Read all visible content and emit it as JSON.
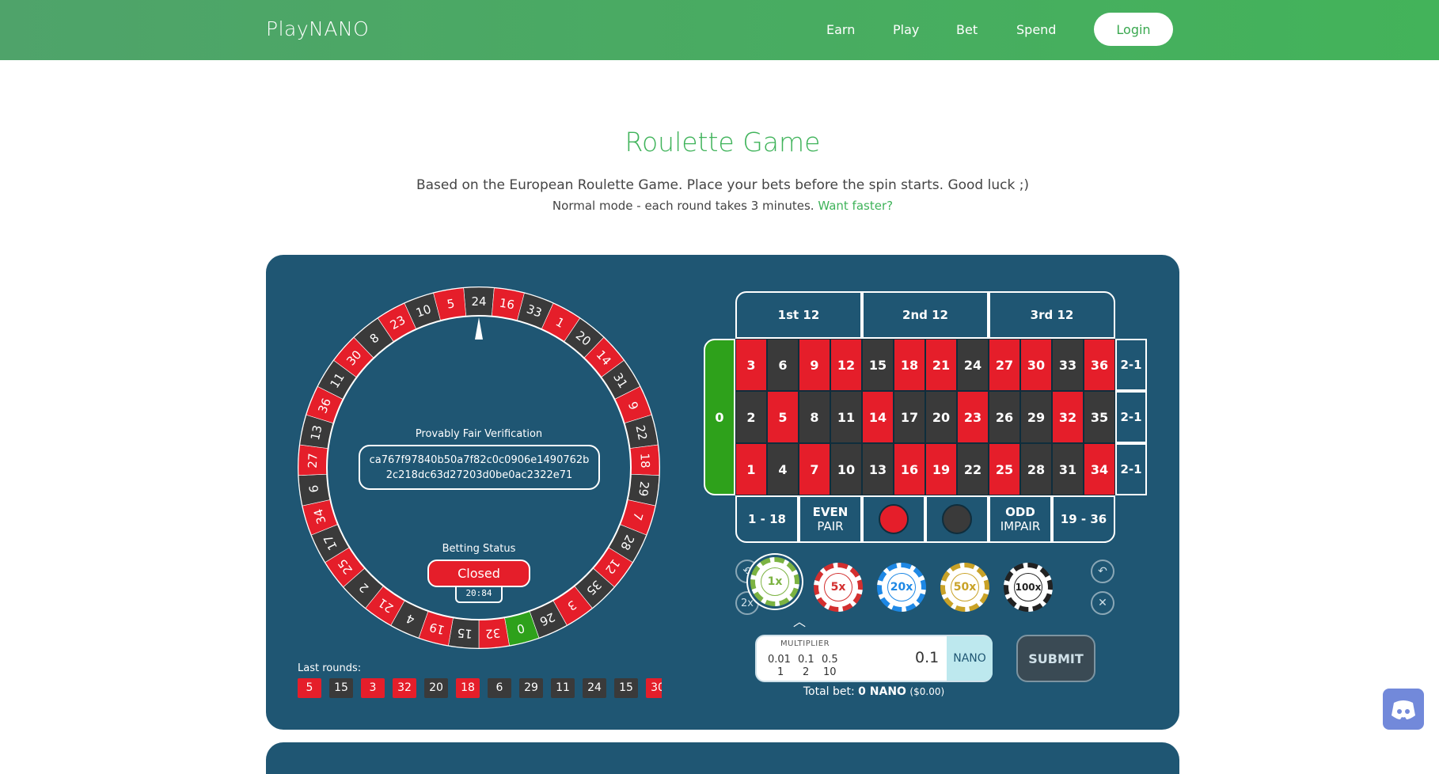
{
  "header": {
    "brand": "PlayNANO",
    "nav": [
      "Earn",
      "Play",
      "Bet",
      "Spend"
    ],
    "login_label": "Login"
  },
  "hero": {
    "title": "Roulette Game",
    "subtitle": "Based on the European Roulette Game. Place your bets before the spin starts. Good luck ;)",
    "mode_text": "Normal mode - each round takes 3 minutes.",
    "mode_link": "Want faster?"
  },
  "wheel": {
    "numbers": [
      24,
      16,
      33,
      1,
      20,
      14,
      31,
      9,
      22,
      18,
      29,
      7,
      28,
      12,
      35,
      3,
      26,
      0,
      32,
      15,
      19,
      4,
      21,
      2,
      25,
      17,
      34,
      6,
      27,
      13,
      36,
      11,
      30,
      8,
      23,
      10,
      5
    ],
    "red_numbers": [
      1,
      3,
      5,
      7,
      9,
      12,
      14,
      16,
      18,
      19,
      21,
      23,
      25,
      27,
      30,
      32,
      34,
      36
    ],
    "verify_label": "Provably Fair Verification",
    "hash_line1": "ca767f97840b50a7f82c0c0906e1490762b",
    "hash_line2": "2c218dc63d27203d0be0ac2322e71",
    "status_label": "Betting Status",
    "status_value": "Closed",
    "timer": "20:84",
    "colors": {
      "red": "#e51e2a",
      "black": "#3a3a3a",
      "green": "#2ea11b"
    }
  },
  "last_rounds": {
    "label": "Last rounds:",
    "values": [
      5,
      15,
      3,
      32,
      20,
      18,
      6,
      29,
      11,
      24,
      15,
      30
    ]
  },
  "table": {
    "dozens": [
      "1st 12",
      "2nd 12",
      "3rd 12"
    ],
    "zero": "0",
    "rows": [
      [
        3,
        6,
        9,
        12,
        15,
        18,
        21,
        24,
        27,
        30,
        33,
        36
      ],
      [
        2,
        5,
        8,
        11,
        14,
        17,
        20,
        23,
        26,
        29,
        32,
        35
      ],
      [
        1,
        4,
        7,
        10,
        13,
        16,
        19,
        22,
        25,
        28,
        31,
        34
      ]
    ],
    "column_bet": "2-1",
    "outside": {
      "low": "1 - 18",
      "even": "EVEN",
      "even_sub": "PAIR",
      "odd": "ODD",
      "odd_sub": "IMPAIR",
      "high": "19 - 36"
    }
  },
  "chips": {
    "values": [
      "1x",
      "5x",
      "20x",
      "50x",
      "100x"
    ],
    "colors": [
      "#7cb342",
      "#d32f2f",
      "#1e88e5",
      "#c9a227",
      "#222222"
    ],
    "double_label": "2x"
  },
  "multiplier": {
    "label": "MULTIPLIER",
    "options_top": [
      "0.01",
      "0.1",
      "0.5"
    ],
    "options_bottom": [
      "1",
      "2",
      "10"
    ],
    "value": "0.1",
    "unit": "NANO"
  },
  "submit_label": "SUBMIT",
  "total_bet": {
    "prefix": "Total bet:",
    "amount": "0 NANO",
    "usd": "($0.00)"
  }
}
